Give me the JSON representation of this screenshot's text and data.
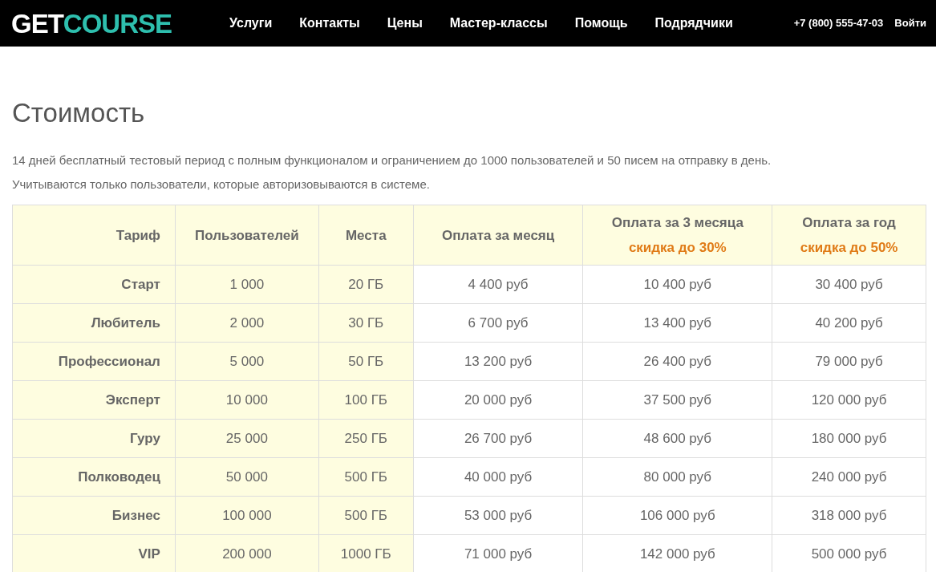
{
  "header": {
    "logo": {
      "part_1": "GET",
      "part_2": "COURSE"
    },
    "nav": [
      "Услуги",
      "Контакты",
      "Цены",
      "Мастер-классы",
      "Помощь",
      "Подрядчики"
    ],
    "phone": "+7 (800) 555-47-03",
    "login": "Войти"
  },
  "title": "Стоимость",
  "intro": [
    "14 дней бесплатный тестовый период с полным функционалом и ограничением до 1000 пользователей и 50 писем на отправку в день.",
    "Учитываются только пользователи, которые авторизовываются в системе."
  ],
  "table": {
    "columns": [
      {
        "title": "Тариф"
      },
      {
        "title": "Пользователей"
      },
      {
        "title": "Места"
      },
      {
        "title": "Оплата за месяц"
      },
      {
        "title": "Оплата за 3 месяца",
        "discount": "скидка до 30%"
      },
      {
        "title": "Оплата за год",
        "discount": "скидка до 50%"
      }
    ],
    "rows": [
      [
        "Старт",
        "1 000",
        "20 ГБ",
        "4 400 руб",
        "10 400 руб",
        "30 400 руб"
      ],
      [
        "Любитель",
        "2 000",
        "30 ГБ",
        "6 700 руб",
        "13 400 руб",
        "40 200 руб"
      ],
      [
        "Профессионал",
        "5 000",
        "50 ГБ",
        "13 200 руб",
        "26 400 руб",
        "79 000 руб"
      ],
      [
        "Эксперт",
        "10 000",
        "100 ГБ",
        "20 000 руб",
        "37 500 руб",
        "120 000 руб"
      ],
      [
        "Гуру",
        "25 000",
        "250 ГБ",
        "26 700 руб",
        "48 600 руб",
        "180 000 руб"
      ],
      [
        "Полководец",
        "50 000",
        "500 ГБ",
        "40 000 руб",
        "80 000 руб",
        "240 000 руб"
      ],
      [
        "Бизнес",
        "100 000",
        "500 ГБ",
        "53 000 руб",
        "106 000 руб",
        "318 000 руб"
      ],
      [
        "VIP",
        "200 000",
        "1000 ГБ",
        "71 000 руб",
        "142 000 руб",
        "500 000 руб"
      ]
    ]
  }
}
